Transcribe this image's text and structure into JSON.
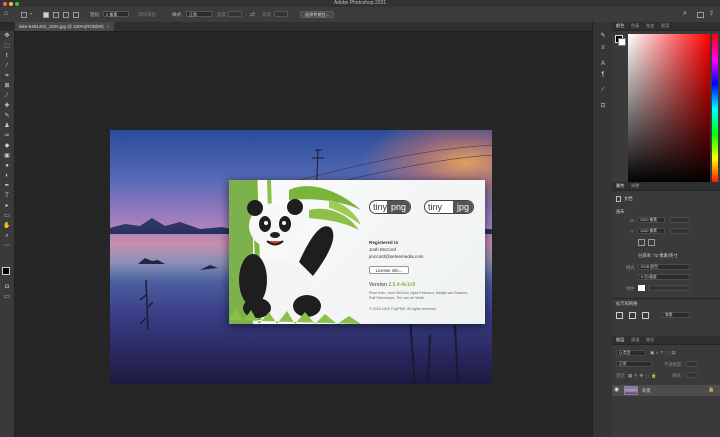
{
  "window": {
    "title": "Adobe Photoshop 2021"
  },
  "options_bar": {
    "feather_label": "羽化:",
    "feather_value": "0 像素",
    "antialias_label": "消除锯齿",
    "style_label": "样式:",
    "style_value": "正常",
    "width_label": "宽度:",
    "height_label": "高度:",
    "select_mask_button": "选择并遮住..."
  },
  "document": {
    "tab_label": "lake-6481492_1920.jpg @ 100%(RGB/8#)"
  },
  "tinypng": {
    "logo_left": [
      "tiny",
      "png"
    ],
    "logo_right": [
      "tiny",
      "jpg"
    ],
    "registered_label": "Registered to",
    "name": "Josh McCord",
    "email": "jmccord@seteemedia.com",
    "license_button": "License info...",
    "version_label": "Version",
    "version_value": "2.5.4-4e1c9",
    "credits": "Plum from, Josh McCord, Alpia Peterson, Martijn van Essenm, Rolf Steinmeyer, Tim van de Velde",
    "copyright": "© 2015-2016 TinyPNG. All rights reserved."
  },
  "color_panel": {
    "tabs": [
      "颜色",
      "色板",
      "渐变",
      "图案"
    ]
  },
  "properties_panel": {
    "tabs": [
      "属性",
      "调整"
    ],
    "doc_label": "文档",
    "canvas_title": "画布",
    "width_label": "W",
    "width_value": "1920 像素",
    "height_label": "H",
    "height_value": "1280 像素",
    "resolution": "分辨率: 72 像素/英寸",
    "mode_label": "模式",
    "mode_value": "RGB 颜色",
    "bit_depth": "8 位/通道",
    "fill_label": "填色",
    "rulers_title": "标尺和网格",
    "units_value": "像素"
  },
  "layers_panel": {
    "tabs": [
      "图层",
      "通道",
      "路径"
    ],
    "search_placeholder": "Q 类型",
    "blend_mode": "正常",
    "opacity_label": "不透明度:",
    "lock_label": "锁定:",
    "fill_label": "填充:",
    "layer_name": "背景"
  },
  "colors": {
    "accent_green": "#8fb446",
    "foreground": "#000000",
    "background": "#ffffff"
  }
}
